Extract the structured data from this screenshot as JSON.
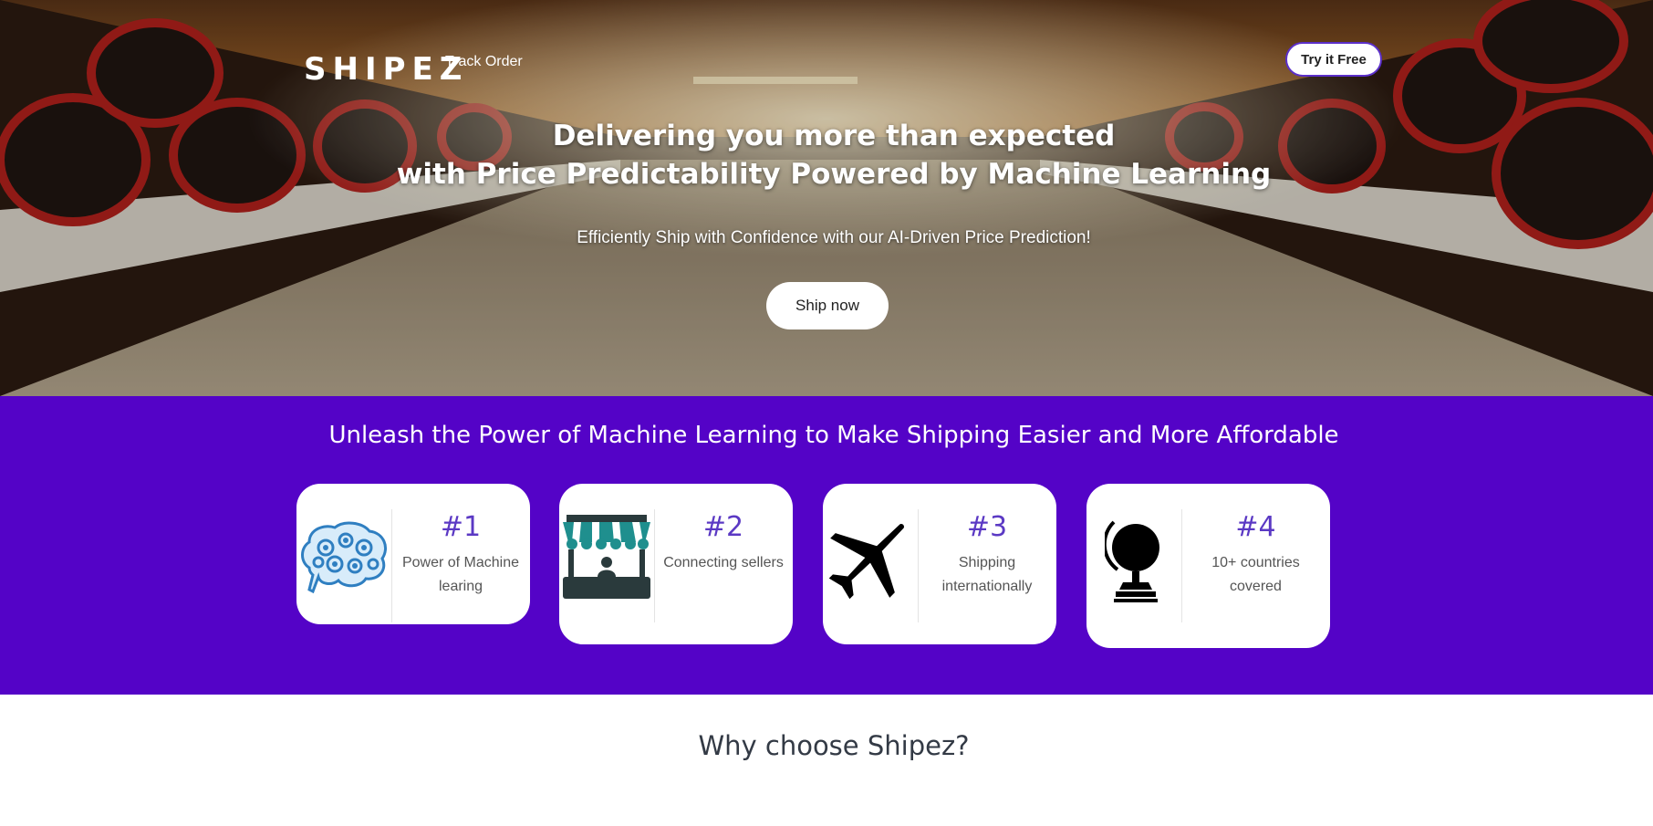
{
  "nav": {
    "logo": "SHIPEZ",
    "track_order": "Track Order",
    "try_free": "Try it Free"
  },
  "hero": {
    "headline_line1": "Delivering you more than expected",
    "headline_line2": "with Price Predictability Powered by Machine Learning",
    "subheadline": "Efficiently Ship with Confidence with our AI-Driven Price Prediction!",
    "cta": "Ship now"
  },
  "features": {
    "title": "Unleash the Power of Machine Learning to Make Shipping Easier and More Affordable",
    "cards": [
      {
        "number": "#1",
        "line1": "Power of Machine",
        "line2": "learing",
        "icon": "brain-gears-icon"
      },
      {
        "number": "#2",
        "line1": "Connecting sellers",
        "line2": "",
        "icon": "market-stall-icon"
      },
      {
        "number": "#3",
        "line1": "Shipping",
        "line2": "internationally",
        "icon": "airplane-icon"
      },
      {
        "number": "#4",
        "line1": "10+ countries",
        "line2": "covered",
        "icon": "globe-icon"
      }
    ]
  },
  "why": {
    "title": "Why choose Shipez?"
  },
  "colors": {
    "brand_purple": "#5403c7",
    "number_purple": "#5b39c4",
    "card_bg": "#ffffff"
  }
}
